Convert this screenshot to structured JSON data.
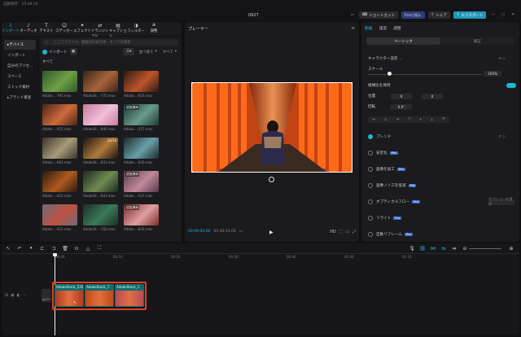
{
  "topbar": {
    "autosave": "自動保存：15:49:24",
    "title": "0927",
    "shortcut": "ショートカット",
    "pro_join": "Proに加入",
    "share": "シェア",
    "export": "エクスポート",
    "accent": "#1f97b8"
  },
  "media_tabs": [
    "インポート",
    "オーディオ",
    "テキスト",
    "ステッカー",
    "エフェクト",
    "トランジション",
    "キャプション",
    "フィルター",
    "調整"
  ],
  "media_tab_icons": [
    "import-icon",
    "audio-icon",
    "text-icon",
    "sticker-icon",
    "effect-icon",
    "transition-icon",
    "caption-icon",
    "filter-icon",
    "adjust-icon"
  ],
  "sidebar": {
    "items": [
      "デバイス",
      "インポート",
      "自分のプリセ...",
      "スペース",
      "ストック素材",
      "ブランド資産"
    ],
    "selected": 0
  },
  "media": {
    "search_placeholder": "ここでファイル、動画内の被写体、セリフを検索",
    "import_label": "インポート",
    "sort_label": "並べ替え",
    "all_label": "すべて",
    "section": "すべて",
    "clips": [
      {
        "name": "Adobe...-791.mov",
        "added": false,
        "dur": ""
      },
      {
        "name": "AdobeSt...-775.mov",
        "added": false,
        "dur": ""
      },
      {
        "name": "Adobe...-833.mov",
        "added": false,
        "dur": ""
      },
      {
        "name": "Adobe...-421.mov",
        "added": false,
        "dur": ""
      },
      {
        "name": "AdobeSt...-846.mov",
        "added": false,
        "dur": ""
      },
      {
        "name": "Adobe...-217.mov",
        "added": true,
        "dur": ""
      },
      {
        "name": "Adobe...-683.mov",
        "added": false,
        "dur": ""
      },
      {
        "name": "AdobeSt...-843.mov",
        "added": false,
        "dur": "00:19"
      },
      {
        "name": "Adobe...-642.mov",
        "added": false,
        "dur": ""
      },
      {
        "name": "Adobe...-421.mov",
        "added": false,
        "dur": ""
      },
      {
        "name": "AdobeSt...-843.mov",
        "added": false,
        "dur": ""
      },
      {
        "name": "Adobe...-037.mov",
        "added": true,
        "dur": ""
      },
      {
        "name": "Adobe...-421.mov",
        "added": false,
        "dur": ""
      },
      {
        "name": "AdobeSt...-350.mov",
        "added": false,
        "dur": ""
      },
      {
        "name": "Adobe...-842.mov",
        "added": true,
        "dur": ""
      }
    ],
    "added_badge": "追加済み"
  },
  "player": {
    "title": "プレーヤー",
    "current_time": "00:00:00:00",
    "total_time": "00:00:15:05"
  },
  "inspector": {
    "tabs": [
      "動画",
      "速度",
      "調整"
    ],
    "subtabs": [
      "ベーシック",
      "補正"
    ],
    "transform": "キャラクター変形",
    "scale_label": "スケール",
    "scale_value": "100%",
    "uniform_scale": "縦横比を保持",
    "position_label": "位置",
    "pos_x": "0",
    "pos_y": "0",
    "rotate_label": "回転",
    "rotate_value": "0.0°",
    "rows": [
      "ブレンド",
      "安定化",
      "画像を加工",
      "画像ノイズを低減",
      "オプティカルフロー",
      "リライト",
      "自動リフレーム"
    ],
    "rows_pro": [
      false,
      true,
      true,
      true,
      true,
      true,
      true
    ],
    "optical_flow_btn": "オプションを選択"
  },
  "timeline": {
    "ticks": [
      "00:00",
      "00:10",
      "00:20",
      "00:30",
      "00:40",
      "01:00",
      "01:10"
    ],
    "cover_label": "カバー",
    "clips": [
      "AdobeStock_535",
      "AdobeStock_7",
      "AdobeStock_1"
    ]
  }
}
